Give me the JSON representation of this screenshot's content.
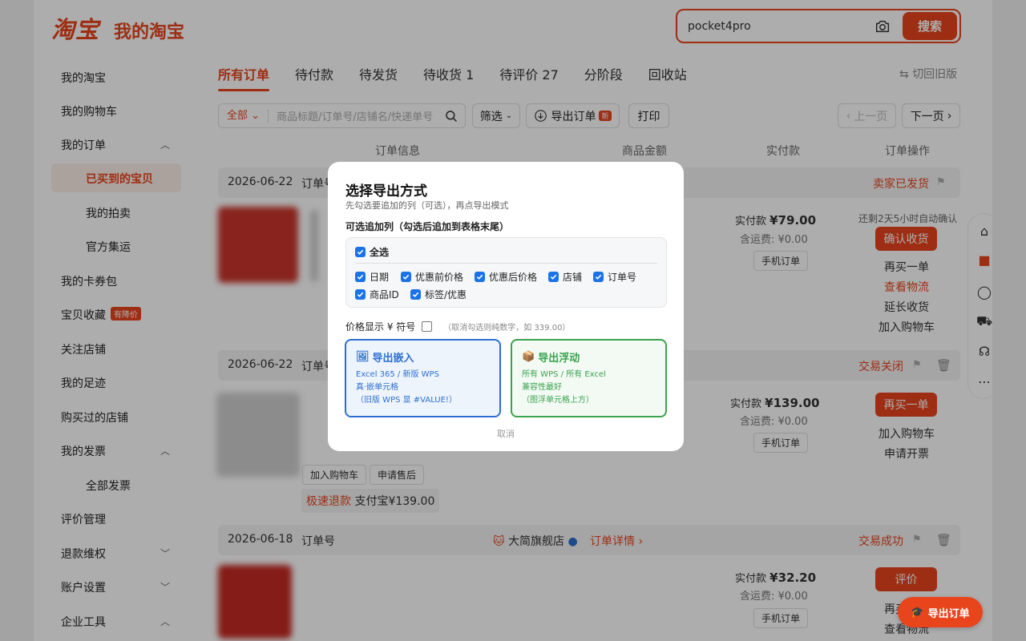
{
  "header": {
    "brand": "淘宝",
    "subtitle": "我的淘宝",
    "search_value": "pocket4pro",
    "search_button": "搜索"
  },
  "sidebar": {
    "items": [
      {
        "label": "我的淘宝"
      },
      {
        "label": "我的购物车"
      },
      {
        "label": "我的订单"
      },
      {
        "label": "已买到的宝贝"
      },
      {
        "label": "我的拍卖"
      },
      {
        "label": "官方集运"
      },
      {
        "label": "我的卡券包"
      },
      {
        "label": "宝贝收藏",
        "badge": "有降价"
      },
      {
        "label": "关注店铺"
      },
      {
        "label": "我的足迹"
      },
      {
        "label": "购买过的店铺"
      },
      {
        "label": "我的发票"
      },
      {
        "label": "全部发票"
      },
      {
        "label": "评价管理"
      },
      {
        "label": "退款维权"
      },
      {
        "label": "账户设置"
      },
      {
        "label": "企业工具"
      }
    ]
  },
  "tabs": [
    "所有订单",
    "待付款",
    "待发货",
    "待收货 1",
    "待评价 27",
    "分阶段",
    "回收站"
  ],
  "old_version": "切回旧版",
  "toolbar": {
    "scope": "全部",
    "search_placeholder": "商品标题/订单号/店铺名/快递单号",
    "filter": "筛选",
    "export": "导出订单",
    "export_badge": "新",
    "print": "打印",
    "prev": "上一页",
    "next": "下一页"
  },
  "columns": [
    "订单信息",
    "商品金额",
    "实付款",
    "订单操作"
  ],
  "orders": [
    {
      "date": "2026-06-22",
      "order_label": "订单号",
      "status": "卖家已发货",
      "paid_label": "实付款",
      "paid": "¥79.00",
      "shipping": "含运费: ¥0.00",
      "channel": "手机订单",
      "countdown": "还剩2天5小时自动确认",
      "primary": "确认收货",
      "links": [
        "再买一单",
        "查看物流",
        "延长收货",
        "加入购物车"
      ]
    },
    {
      "date": "2026-06-22",
      "order_label": "订单号",
      "status": "交易关闭",
      "paid_label": "实付款",
      "paid": "¥139.00",
      "shipping": "含运费: ¥0.00",
      "channel": "手机订单",
      "primary": "再买一单",
      "links": [
        "加入购物车",
        "申请开票"
      ],
      "actions": [
        "加入购物车",
        "申请售后"
      ],
      "refund_tag": "极速退款",
      "refund_text": "支付宝¥139.00"
    },
    {
      "date": "2026-06-18",
      "order_label": "订单号",
      "shop": "大简旗舰店",
      "detail": "订单详情",
      "status": "交易成功",
      "paid_label": "实付款",
      "paid": "¥32.20",
      "shipping": "含运费: ¥0.00",
      "channel": "手机订单",
      "primary": "评价",
      "links": [
        "再买一单",
        "查看物流"
      ]
    }
  ],
  "modal": {
    "title": "选择导出方式",
    "subtitle": "先勾选要追加的列（可选），再点导出模式",
    "section": "可选追加列（勾选后追加到表格末尾）",
    "select_all": "全选",
    "columns": [
      "日期",
      "优惠前价格",
      "优惠后价格",
      "店铺",
      "订单号",
      "商品ID",
      "标签/优惠"
    ],
    "price_label": "价格显示 ¥ 符号",
    "price_hint": "（取消勾选则纯数字，如 339.00）",
    "embed": {
      "title": "导出嵌入",
      "lines": [
        "Excel 365 / 新版 WPS",
        "真·嵌单元格",
        "（旧版 WPS 显 #VALUE!）"
      ]
    },
    "float": {
      "title": "导出浮动",
      "lines": [
        "所有 WPS / 所有 Excel",
        "兼容性最好",
        "（图浮单元格上方）"
      ]
    },
    "cancel": "取消"
  },
  "fab": {
    "label": "导出订单"
  },
  "colors": {
    "accent": "#e8451d",
    "blue": "#2c6fd1",
    "green": "#3ba24f"
  }
}
